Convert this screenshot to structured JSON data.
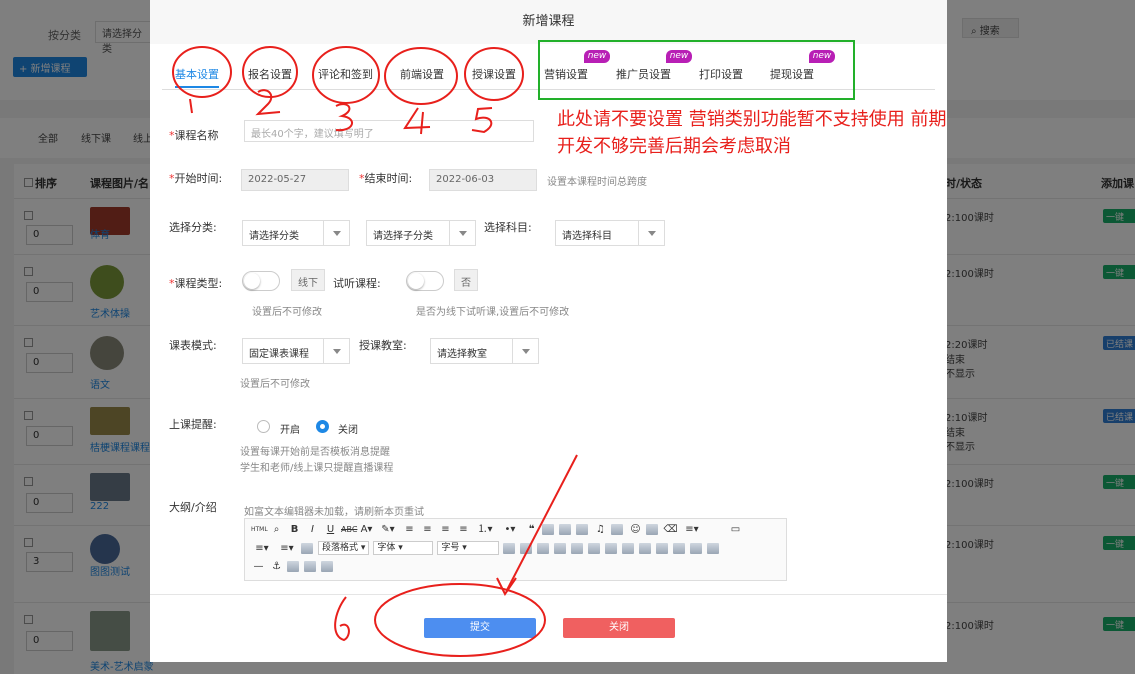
{
  "background": {
    "search_label": "按分类",
    "category_select": "请选择分类",
    "add_course_button": "+ 新增课程",
    "search_button": "搜索",
    "filters": [
      "全部",
      "线下课",
      "线上"
    ],
    "table_headers": {
      "sort": "排序",
      "image_name": "课程图片/名",
      "status": "时/状态",
      "add": "添加课"
    },
    "rows": [
      {
        "order": "0",
        "name": "体育",
        "status": "2:100课时",
        "action": "一键"
      },
      {
        "order": "0",
        "name": "艺术体操",
        "status": "2:100课时",
        "action": "一键"
      },
      {
        "order": "0",
        "name": "语文",
        "status": "2:20课时",
        "status2": "结束",
        "status3": "不显示",
        "action": "已结课"
      },
      {
        "order": "0",
        "name": "桔梗课程课程",
        "status": "2:10课时",
        "status2": "结束",
        "status3": "不显示",
        "action": "已结课"
      },
      {
        "order": "0",
        "name": "222",
        "status": "2:100课时",
        "action": "一键"
      },
      {
        "order": "3",
        "name": "图图测试",
        "status": "2:100课时",
        "action": "一键"
      },
      {
        "order": "0",
        "name": "美术-艺术启蒙",
        "status": "2:100课时",
        "action": "一键"
      }
    ]
  },
  "modal": {
    "title": "新增课程",
    "tabs": [
      "基本设置",
      "报名设置",
      "评论和签到",
      "前端设置",
      "授课设置",
      "营销设置",
      "推广员设置",
      "打印设置",
      "提现设置"
    ],
    "new_badge": "new",
    "fields": {
      "course_name_label": "课程名称",
      "course_name_placeholder": "最长40个字，建议填写明了",
      "start_time_label": "开始时间:",
      "start_time_value": "2022-05-27",
      "end_time_label": "结束时间:",
      "end_time_value": "2022-06-03",
      "time_hint": "设置本课程时间总跨度",
      "category_label": "选择分类:",
      "category_value": "请选择分类",
      "subcategory_value": "请选择子分类",
      "subject_label": "选择科目:",
      "subject_value": "请选择科目",
      "course_type_label": "课程类型:",
      "course_type_value": "线下",
      "trial_label": "试听课程:",
      "trial_value": "否",
      "course_type_hint": "设置后不可修改",
      "trial_hint": "是否为线下试听课,设置后不可修改",
      "schedule_mode_label": "课表模式:",
      "schedule_mode_value": "固定课表课程",
      "classroom_label": "授课教室:",
      "classroom_value": "请选择教室",
      "schedule_hint": "设置后不可修改",
      "reminder_label": "上课提醒:",
      "reminder_on": "开启",
      "reminder_off": "关闭",
      "reminder_hint1": "设置每课开始前是否模板消息提醒",
      "reminder_hint2": "学生和老师/线上课只提醒直播课程",
      "outline_label": "大纲/介绍",
      "editor_hint": "如富文本编辑器未加载，请刷新本页重试",
      "editor_paragraph": "段落格式",
      "editor_font": "字体",
      "editor_size": "字号"
    },
    "submit_button": "提交",
    "close_button": "关闭"
  },
  "annotation": {
    "note": "此处请不要设置 营销类别功能暂不支持使用 前期开发不够完善后期会考虑取消",
    "accent_color": "#e8201c",
    "green_box_color": "#22b02a"
  }
}
